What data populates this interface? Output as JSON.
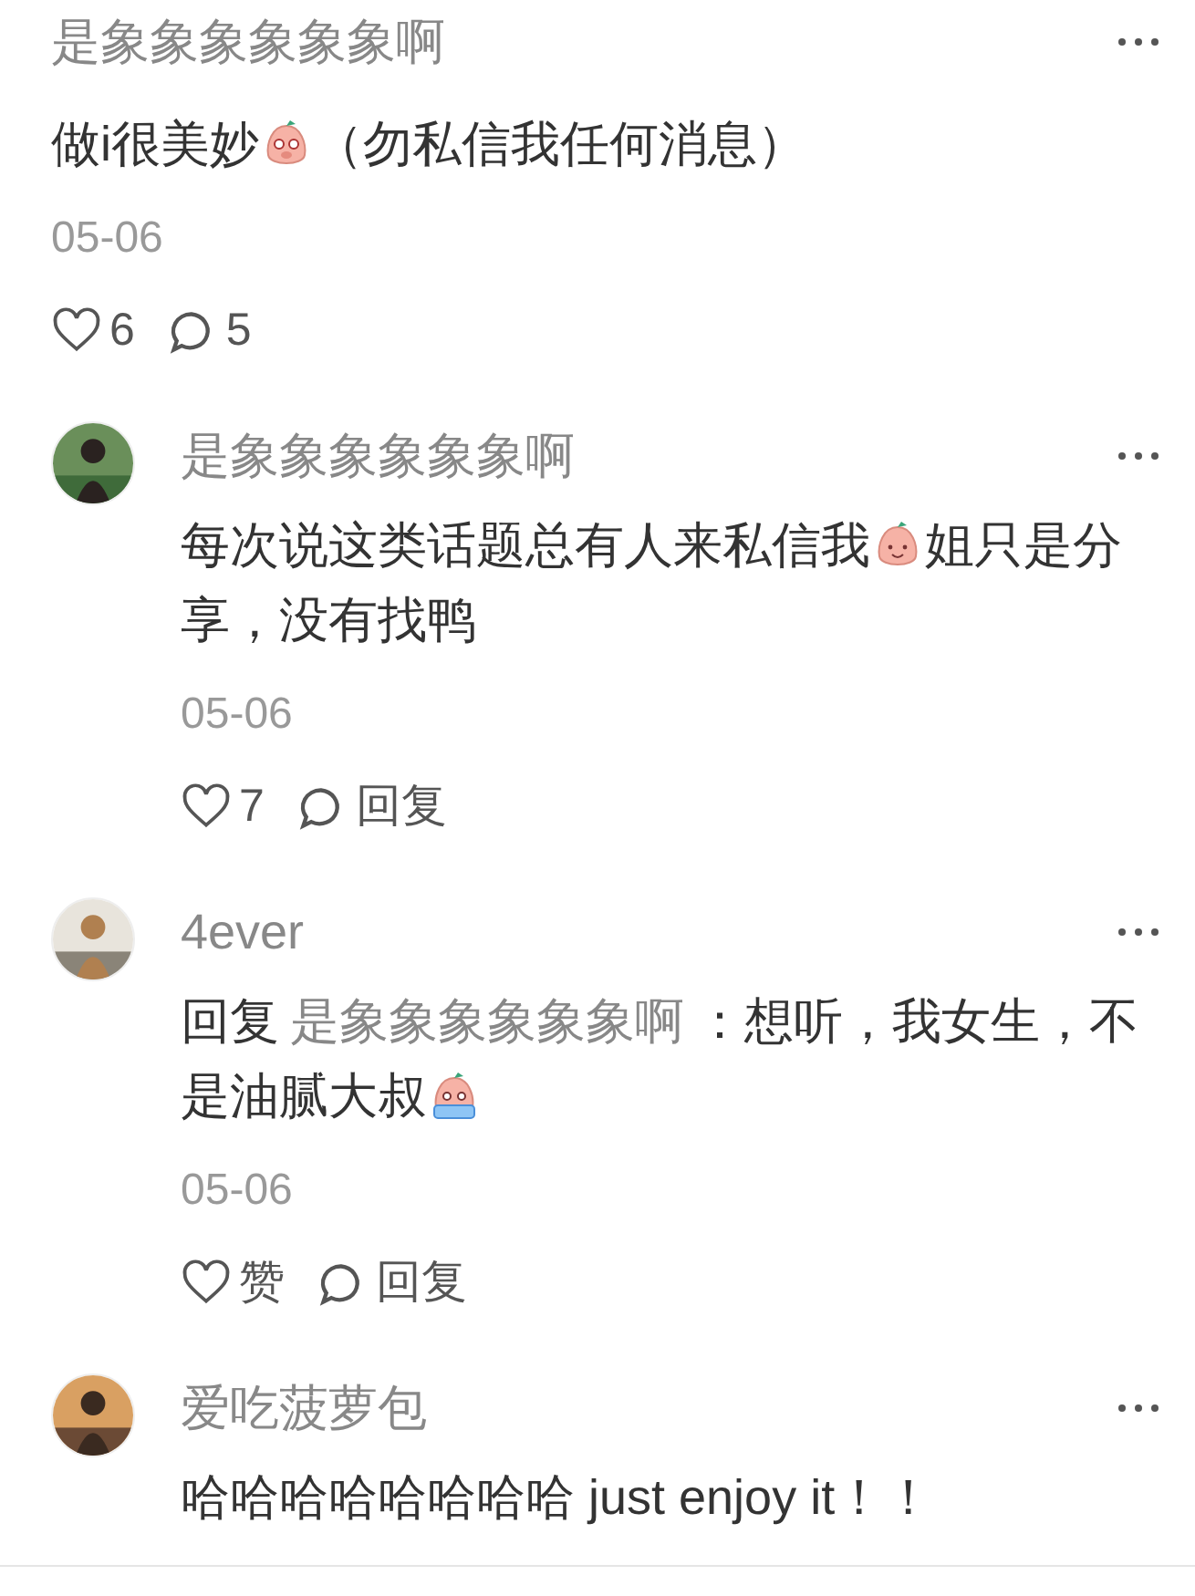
{
  "comment": {
    "author": "是象象象象象象啊",
    "body": [
      {
        "kind": "text",
        "text": "做i很美妙"
      },
      {
        "kind": "shy"
      },
      {
        "kind": "text",
        "text": "（勿私信我任何消息）"
      }
    ],
    "date": "05-06",
    "likes": "6",
    "replies_count": "5"
  },
  "replies": [
    {
      "author": "是象象象象象象啊",
      "avatar": {
        "kind": "picture"
      },
      "body": [
        {
          "kind": "text",
          "text": "每次说这类话题总有人来私信我"
        },
        {
          "kind": "smile"
        },
        {
          "kind": "text",
          "text": "姐只是分享，没有找鸭"
        }
      ],
      "date": "05-06",
      "like_label": "7",
      "reply_label": "回复"
    },
    {
      "author": "4ever",
      "avatar": {
        "kind": "picture"
      },
      "body": [
        {
          "kind": "text",
          "text": "回复"
        },
        {
          "kind": "mention",
          "text": "是象象象象象象啊"
        },
        {
          "kind": "text",
          "text": "：想听，我女生，不是油腻大叔"
        },
        {
          "kind": "cry"
        }
      ],
      "date": "05-06",
      "like_label": "赞",
      "reply_label": "回复"
    },
    {
      "author": "爱吃菠萝包",
      "avatar": {
        "kind": "picture"
      },
      "body": [
        {
          "kind": "text",
          "text": "哈哈哈哈哈哈哈哈 just enjoy it！！"
        }
      ]
    }
  ]
}
